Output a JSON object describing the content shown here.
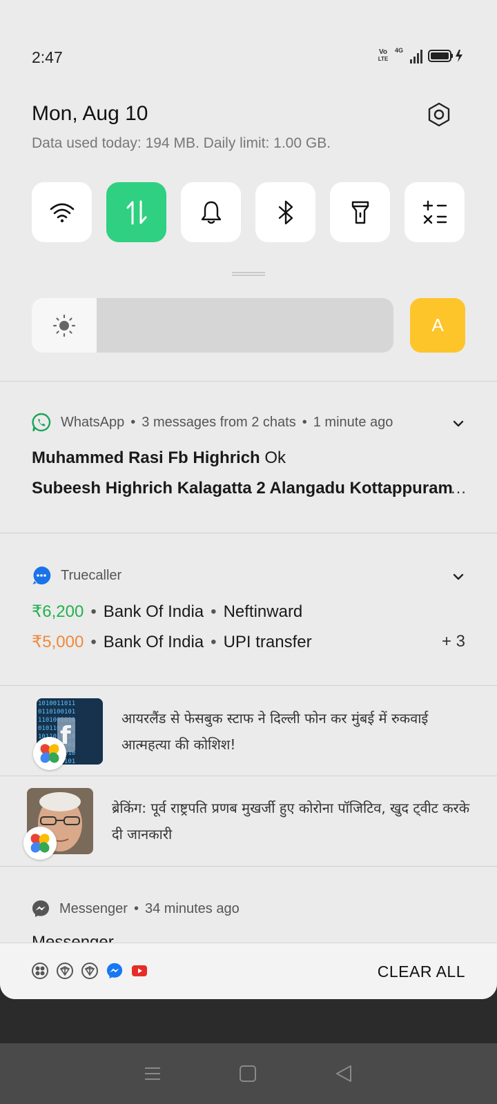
{
  "status_bar": {
    "time": "2:47",
    "volte_top": "Vo",
    "volte_bottom": "LTE",
    "network": "4G"
  },
  "header": {
    "date": "Mon, Aug 10",
    "data_usage": "Data used today: 194 MB. Daily limit: 1.00 GB."
  },
  "quick_tiles": [
    {
      "name": "wifi-icon",
      "active": false
    },
    {
      "name": "mobile-data-icon",
      "active": true
    },
    {
      "name": "bell-icon",
      "active": false
    },
    {
      "name": "bluetooth-icon",
      "active": false
    },
    {
      "name": "flashlight-icon",
      "active": false
    },
    {
      "name": "calculator-icon",
      "active": false
    }
  ],
  "brightness": {
    "level": 0.18,
    "auto_label": "A"
  },
  "colors": {
    "active_tile": "#2fd081",
    "auto_button": "#fdc52a",
    "amount_green": "#22b24c",
    "amount_orange": "#f0883b"
  },
  "whatsapp": {
    "app": "WhatsApp",
    "summary": "3 messages from 2 chats",
    "time": "1 minute ago",
    "messages": [
      {
        "sender": "Muhammed Rasi Fb Highrich",
        "text": "Ok"
      },
      {
        "sender": "Subeesh Highrich Kalagatta 2 Alangadu Kottappuram",
        "text": ""
      }
    ],
    "ellipsis": "…"
  },
  "truecaller": {
    "app": "Truecaller",
    "rows": [
      {
        "amount": "₹6,200",
        "bank": "Bank Of India",
        "type": "Neftinward"
      },
      {
        "amount": "₹5,000",
        "bank": "Bank Of India",
        "type": "UPI transfer"
      }
    ],
    "more": "+ 3"
  },
  "news": [
    {
      "text": "आयरलैंड से फेसबुक स्टाफ ने दिल्ली फोन कर मुंबई में रुकवाई आत्महत्या की कोशिश!"
    },
    {
      "text": "ब्रेकिंग: पूर्व राष्ट्रपति प्रणब मुखर्जी हुए कोरोना पॉजिटिव, खुद ट्वीट करके दी जानकारी"
    }
  ],
  "messenger": {
    "app": "Messenger",
    "time": "34 minutes ago",
    "title_partial": "Messenger"
  },
  "bottom": {
    "clear_all": "CLEAR ALL"
  }
}
